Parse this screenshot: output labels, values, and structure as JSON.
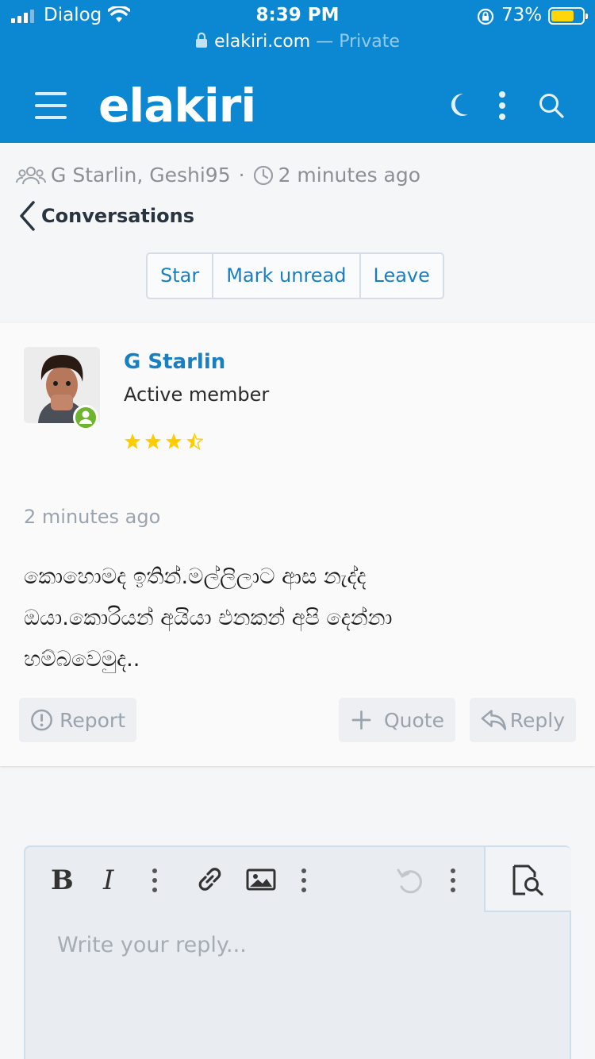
{
  "status_bar": {
    "carrier": "Dialog",
    "time": "8:39 PM",
    "battery_percent": "73%",
    "battery_level": 0.73
  },
  "browser": {
    "host": "elakiri.com",
    "mode": "— Private"
  },
  "site": {
    "logo": "elakiri",
    "colors": {
      "header": "#0c87d1",
      "link": "#1a7fc1",
      "online": "#6cb52c",
      "star": "#ffcc00"
    }
  },
  "conversation": {
    "participants": "G Starlin, Geshi95",
    "separator": "·",
    "updated": "2 minutes ago",
    "back_label": "Conversations",
    "actions": {
      "star": "Star",
      "mark_unread": "Mark unread",
      "leave": "Leave"
    }
  },
  "message": {
    "author": "G Starlin",
    "user_title": "Active member",
    "rating_stars": 3.5,
    "time": "2 minutes ago",
    "body_lines": [
      "කොහොමද ඉතින්.මල්ලිලාට ආස නැද්ද",
      "ඔයා.කොරියන් අයියා එනකන් අපි දෙන්නා",
      "හම්බවෙමුද.."
    ],
    "report_label": "Report",
    "quote_label": "Quote",
    "reply_label": "Reply"
  },
  "editor": {
    "placeholder": "Write your reply..."
  }
}
